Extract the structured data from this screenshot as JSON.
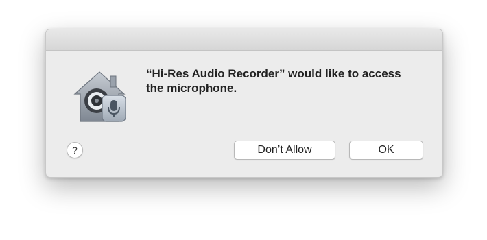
{
  "dialog": {
    "message": "“Hi-Res Audio Recorder” would like to access the microphone.",
    "help_label": "?",
    "buttons": {
      "dont_allow": "Don’t Allow",
      "ok": "OK"
    },
    "icons": {
      "app_icon": "security-house-microphone-icon",
      "help_icon": "question-mark-icon"
    }
  }
}
